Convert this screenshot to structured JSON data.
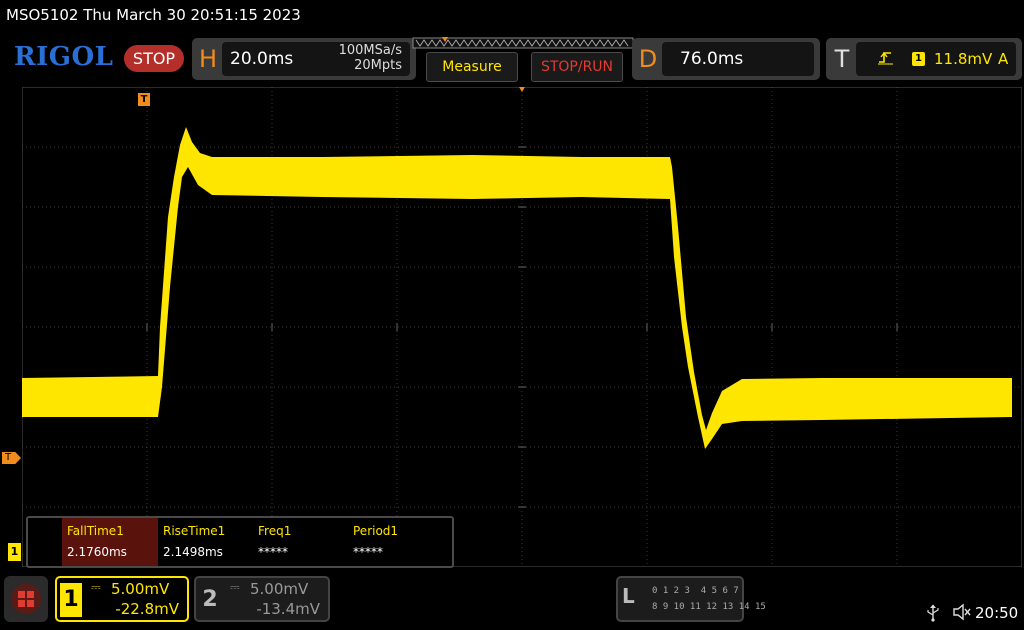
{
  "header": {
    "model_datetime": "MSO5102  Thu March 30 20:51:15 2023",
    "logo": "RIGOL",
    "run_state": "STOP"
  },
  "horizontal": {
    "letter": "H",
    "timebase": "20.0ms",
    "sample_rate": "100MSa/s",
    "memory_depth": "20Mpts"
  },
  "buttons": {
    "measure": "Measure",
    "stop_run": "STOP/RUN"
  },
  "delay": {
    "letter": "D",
    "value": "76.0ms"
  },
  "trigger": {
    "letter": "T",
    "edge_icon": "rising-edge-icon",
    "source": "1",
    "level": "11.8mV",
    "mode": "A"
  },
  "markers": {
    "trigger_position": "T",
    "trigger_level": "T",
    "channel1": "1"
  },
  "measurements": [
    {
      "label": "FallTime1",
      "value": "2.1760ms"
    },
    {
      "label": "RiseTime1",
      "value": "2.1498ms"
    },
    {
      "label": "Freq1",
      "value": "*****"
    },
    {
      "label": "Period1",
      "value": "*****"
    }
  ],
  "channels": [
    {
      "number": "1",
      "coupling": "⎓",
      "scale": "5.00mV",
      "offset": "-22.8mV",
      "active": true
    },
    {
      "number": "2",
      "coupling": "⎓",
      "scale": "5.00mV",
      "offset": "-13.4mV",
      "active": false
    }
  ],
  "logic_analyzer": {
    "letter": "L",
    "row1": "0 1 2 3  4 5 6 7",
    "row2": "8 9 10 11 12 13 14 15"
  },
  "status": {
    "usb_icon": "usb-icon",
    "speaker_icon": "speaker-muted-icon",
    "time": "20:50"
  },
  "colors": {
    "trace": "#ffe600",
    "accent_orange": "#f08d1c",
    "stop_red": "#b52f2a",
    "logo_blue": "#2a6fd6"
  }
}
